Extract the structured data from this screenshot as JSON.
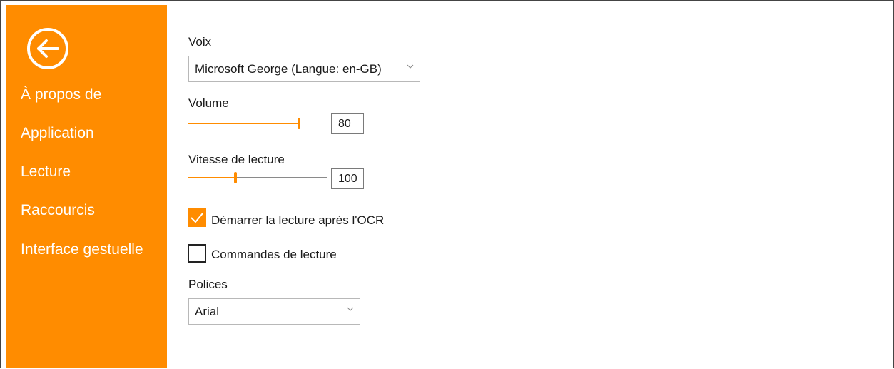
{
  "sidebar": {
    "back_icon": "back-arrow-circle-icon",
    "items": [
      {
        "label": "À propos de"
      },
      {
        "label": "Application"
      },
      {
        "label": "Lecture"
      },
      {
        "label": "Raccourcis"
      },
      {
        "label": "Interface gestuelle"
      }
    ],
    "color": "#ff8c00"
  },
  "settings": {
    "voice": {
      "label": "Voix",
      "value": "Microsoft George (Langue: en-GB)"
    },
    "volume": {
      "label": "Volume",
      "value": "80",
      "level": 0.8
    },
    "speed": {
      "label": "Vitesse de lecture",
      "value": "100",
      "level": 0.34
    },
    "auto_read": {
      "label": "Démarrer la lecture après l'OCR",
      "checked": true
    },
    "read_controls": {
      "label": "Commandes de lecture",
      "checked": false
    },
    "fonts": {
      "label": "Polices",
      "value": "Arial"
    }
  }
}
